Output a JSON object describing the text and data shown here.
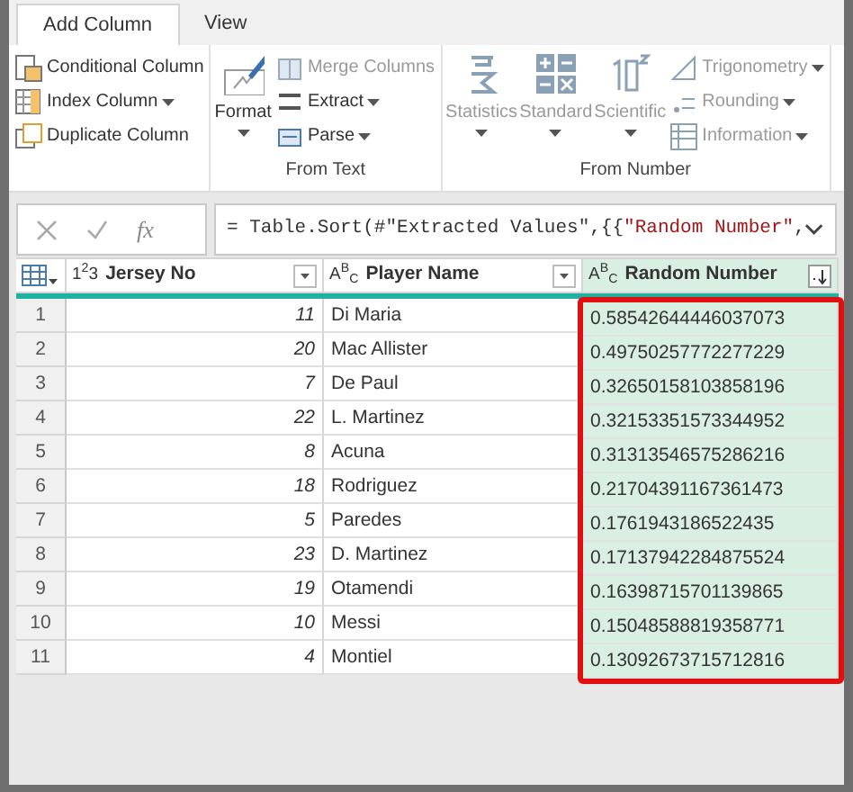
{
  "tabs": [
    {
      "label": "Add Column",
      "selected": true
    },
    {
      "label": "View",
      "selected": false
    }
  ],
  "ribbon": {
    "general": [
      {
        "label": "Conditional Column",
        "dropdown": false,
        "disabled": false
      },
      {
        "label": "Index Column",
        "dropdown": true,
        "disabled": false
      },
      {
        "label": "Duplicate Column",
        "dropdown": false,
        "disabled": false
      }
    ],
    "from_text": {
      "label": "From Text",
      "large": [
        {
          "label": "Format",
          "dropdown": true,
          "disabled": false
        }
      ],
      "items": [
        {
          "label": "Merge Columns",
          "dropdown": false,
          "disabled": true
        },
        {
          "label": "Extract",
          "dropdown": true,
          "disabled": false
        },
        {
          "label": "Parse",
          "dropdown": true,
          "disabled": false
        }
      ]
    },
    "from_number": {
      "label": "From Number",
      "large": [
        {
          "label": "Statistics",
          "dropdown": true,
          "disabled": true
        },
        {
          "label": "Standard",
          "dropdown": true,
          "disabled": true
        },
        {
          "label": "Scientific",
          "dropdown": true,
          "disabled": true
        }
      ],
      "items": [
        {
          "label": "Trigonometry",
          "dropdown": true,
          "disabled": true
        },
        {
          "label": "Rounding",
          "dropdown": true,
          "disabled": true
        },
        {
          "label": "Information",
          "dropdown": true,
          "disabled": true
        }
      ]
    }
  },
  "formula_bar": {
    "fx": "fx",
    "segments": [
      {
        "text": "= Table.Sort(#\"Extracted Values\",{{",
        "kind": "code"
      },
      {
        "text": "\"Random Number\"",
        "kind": "string"
      },
      {
        "text": ",",
        "kind": "code"
      }
    ]
  },
  "table": {
    "columns": [
      {
        "type_label": "1$^{2}$3",
        "title": "Jersey No",
        "numeric": true,
        "selected": false,
        "sorted_descending": false,
        "highlighted": false
      },
      {
        "type_label": "A$^{B}$$_{C}$",
        "title": "Player Name",
        "numeric": false,
        "selected": false,
        "sorted_descending": false,
        "highlighted": false
      },
      {
        "type_label": "A$^{B}$$_{C}$",
        "title": "Random Number",
        "numeric": false,
        "selected": true,
        "sorted_descending": true,
        "highlighted": true
      }
    ],
    "rows": [
      {
        "index": "1",
        "cells": [
          "11",
          "Di Maria",
          "0.58542644446037073"
        ]
      },
      {
        "index": "2",
        "cells": [
          "20",
          "Mac Allister",
          "0.49750257772277229"
        ]
      },
      {
        "index": "3",
        "cells": [
          "7",
          "De Paul",
          "0.32650158103858196"
        ]
      },
      {
        "index": "4",
        "cells": [
          "22",
          "L. Martinez",
          "0.32153351573344952"
        ]
      },
      {
        "index": "5",
        "cells": [
          "8",
          "Acuna",
          "0.31313546575286216"
        ]
      },
      {
        "index": "6",
        "cells": [
          "18",
          "Rodriguez",
          "0.21704391167361473"
        ]
      },
      {
        "index": "7",
        "cells": [
          "5",
          "Paredes",
          "0.1761943186522435"
        ]
      },
      {
        "index": "8",
        "cells": [
          "23",
          "D. Martinez",
          "0.17137942284875524"
        ]
      },
      {
        "index": "9",
        "cells": [
          "19",
          "Otamendi",
          "0.16398715701139865"
        ]
      },
      {
        "index": "10",
        "cells": [
          "10",
          "Messi",
          "0.15048588819358771"
        ]
      },
      {
        "index": "11",
        "cells": [
          "4",
          "Montiel",
          "0.13092673715712816"
        ]
      }
    ]
  }
}
